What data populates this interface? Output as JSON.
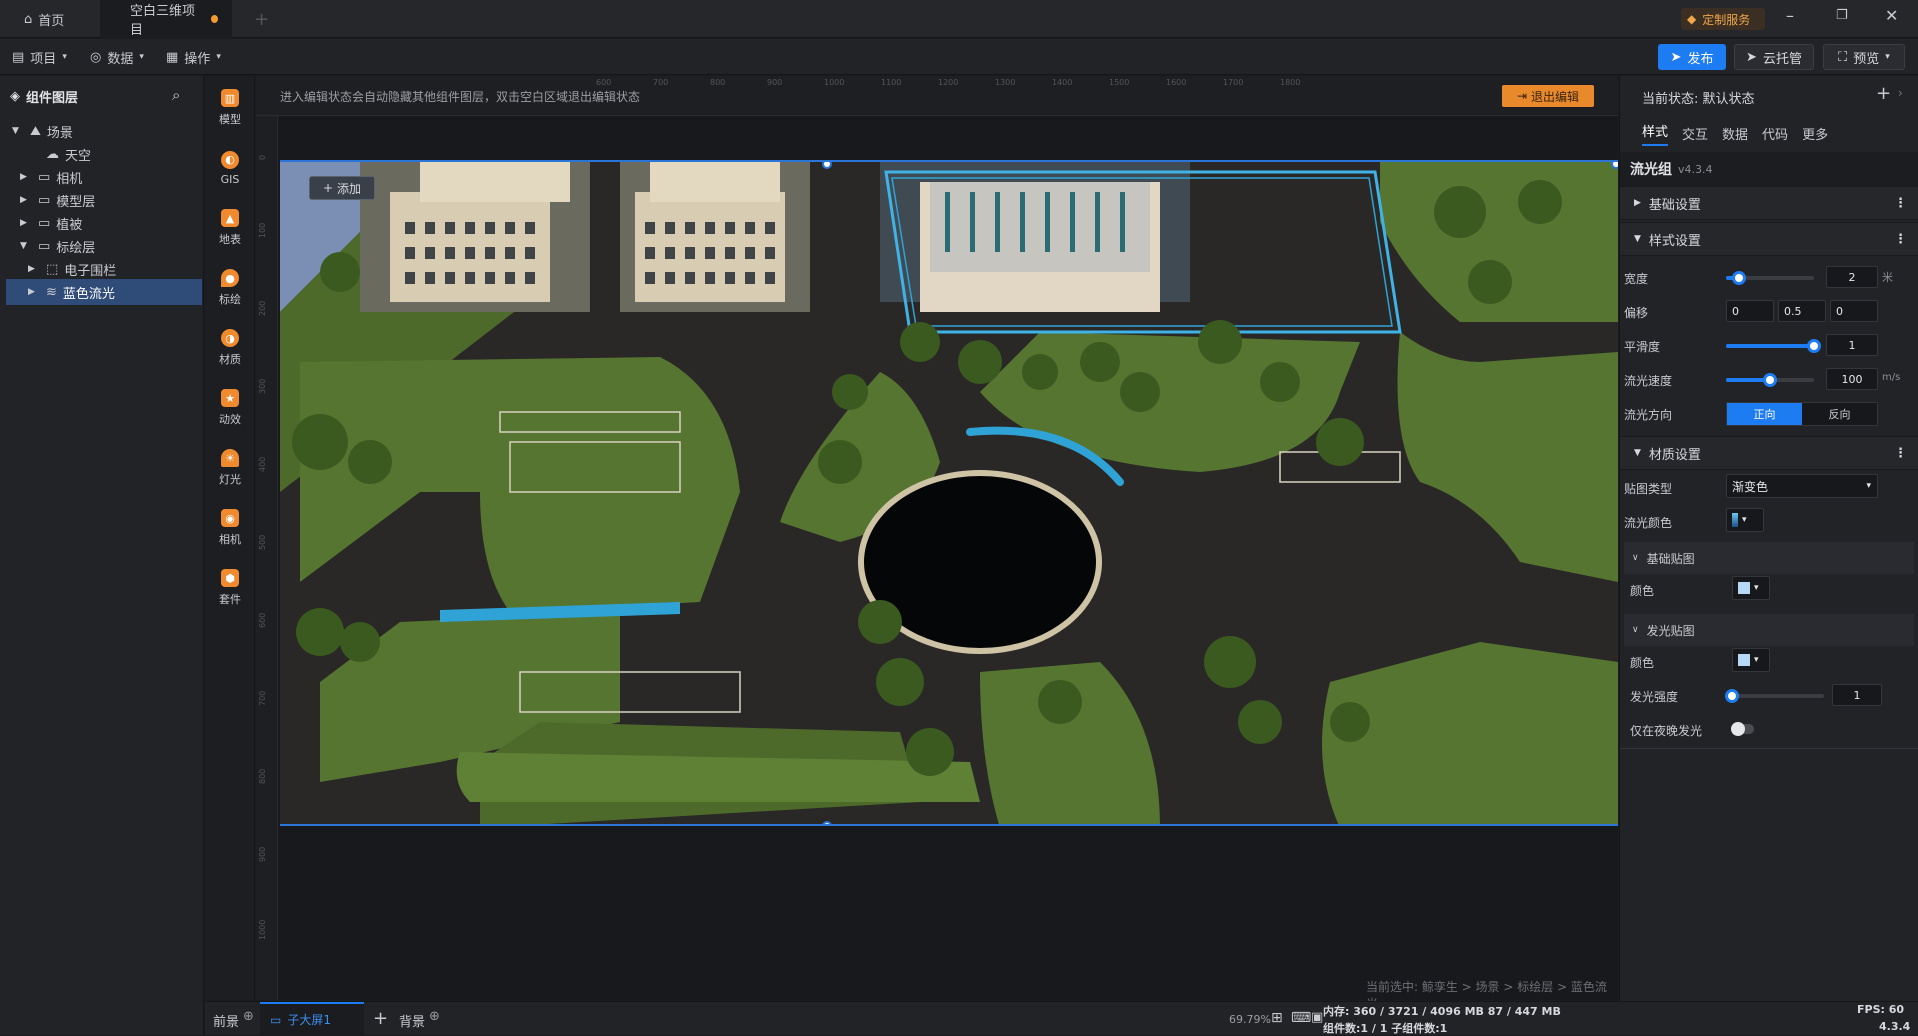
{
  "tabs": {
    "home": "首页",
    "project": "空白三维项目"
  },
  "titlebar": {
    "custom_service": "定制服务"
  },
  "menu": {
    "project": "项目",
    "data": "数据",
    "operate": "操作"
  },
  "toolbar": {
    "publish": "发布",
    "cloud": "云托管",
    "preview": "预览"
  },
  "layers": {
    "title": "组件图层",
    "items": [
      {
        "label": "场景"
      },
      {
        "label": "天空"
      },
      {
        "label": "相机"
      },
      {
        "label": "模型层"
      },
      {
        "label": "植被"
      },
      {
        "label": "标绘层"
      },
      {
        "label": "电子围栏"
      },
      {
        "label": "蓝色流光"
      }
    ]
  },
  "sidetools": [
    "模型",
    "GIS",
    "地表",
    "标绘",
    "材质",
    "动效",
    "灯光",
    "相机",
    "套件"
  ],
  "canvas": {
    "hint": "进入编辑状态会自动隐藏其他组件图层，双击空白区域退出编辑状态",
    "exit_edit": "退出编辑",
    "add": "添加",
    "ruler_top": [
      "600",
      "700",
      "800",
      "900",
      "1000",
      "1100",
      "1200",
      "1300",
      "1400",
      "1500",
      "1600",
      "1700",
      "1800"
    ],
    "ruler_left": [
      "0",
      "100",
      "200",
      "300",
      "400",
      "500",
      "600",
      "700",
      "800",
      "900",
      "1000",
      "100"
    ],
    "breadcrumb": "当前选中: 鲸孪生 > 场景 > 标绘层 > 蓝色流光"
  },
  "right": {
    "state": "当前状态:  默认状态",
    "tabs": [
      "样式",
      "交互",
      "数据",
      "代码",
      "更多"
    ],
    "component": "流光组",
    "version": "v4.3.4",
    "sections": {
      "basic": "基础设置",
      "style": "样式设置",
      "material": "材质设置",
      "base_map": "基础贴图",
      "glow_map": "发光贴图"
    },
    "width_label": "宽度",
    "width_value": "2",
    "width_unit": "米",
    "width_level": 0.15,
    "offset_label": "偏移",
    "offset": [
      "0",
      "0.5",
      "0"
    ],
    "smooth_label": "平滑度",
    "smooth_value": "1",
    "smooth_level": 1.0,
    "speed_label": "流光速度",
    "speed_value": "100",
    "speed_unit": "m/s",
    "speed_level": 0.5,
    "direction_label": "流光方向",
    "dir_forward": "正向",
    "dir_reverse": "反向",
    "texture_type_label": "贴图类型",
    "texture_type": "渐变色",
    "flow_color_label": "流光颜色",
    "color_label": "颜色",
    "glow_strength_label": "发光强度",
    "glow_strength_value": "1",
    "glow_level": 0.0,
    "night_only_label": "仅在夜晚发光"
  },
  "bottom": {
    "front": "前景",
    "screen": "子大屏1",
    "background": "背景",
    "zoom": "69.79%",
    "memory": "内存:  360 / 3721 / 4096 MB  87 / 447 MB",
    "fps": "FPS:  60",
    "counts": "组件数:1 / 1   子组件数:1",
    "version": "4.3.4"
  },
  "colors": {
    "accent": "#1e7cf2",
    "orange": "#f08a2e",
    "selected": "#2f4b78",
    "flow_blue": "#2fa3d6"
  }
}
